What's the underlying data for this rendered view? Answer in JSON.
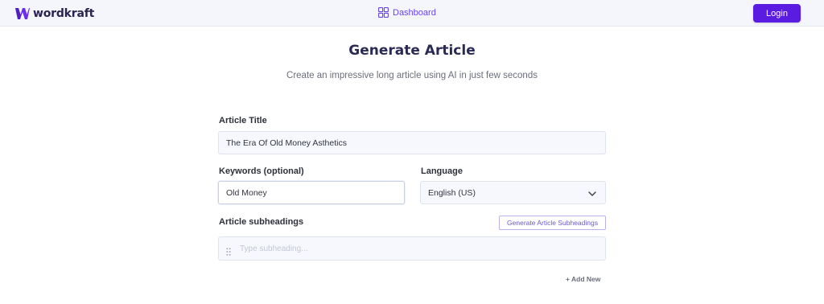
{
  "brand": {
    "name": "wordkraft",
    "logo_color": "#6a2cf0"
  },
  "nav": {
    "dashboard_label": "Dashboard",
    "dashboard_icon": "grid-icon",
    "login_label": "Login"
  },
  "colors": {
    "accent": "#5a1ce0",
    "title": "#2b2a55"
  },
  "page": {
    "title": "Generate Article",
    "subtitle": "Create an impressive long article using AI in just few seconds"
  },
  "form": {
    "article_title": {
      "label": "Article Title",
      "value": "The Era Of Old Money Asthetics"
    },
    "keywords": {
      "label": "Keywords (optional)",
      "value": "Old Money"
    },
    "language": {
      "label": "Language",
      "value": "English (US)"
    },
    "subheadings": {
      "label": "Article subheadings",
      "generate_button": "Generate Article Subheadings",
      "placeholder": "Type subheading...",
      "add_new": "+ Add New"
    }
  }
}
